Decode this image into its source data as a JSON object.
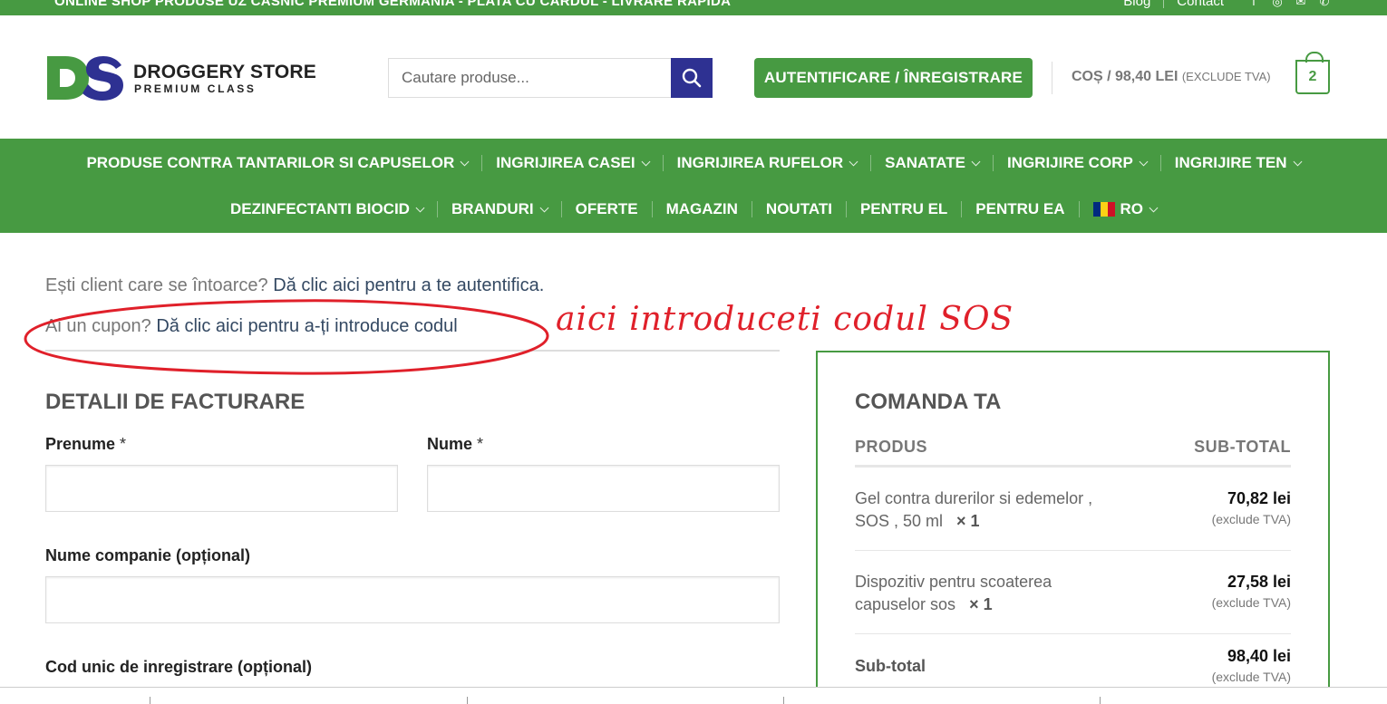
{
  "topbar": {
    "promo": "ONLINE SHOP PRODUSE UZ CASNIC PREMIUM GERMANIA - PLATA CU CARDUL - LIVRARE RAPIDA",
    "links": [
      "Blog",
      "Contact"
    ],
    "social_icons": [
      "facebook-icon",
      "instagram-icon",
      "email-icon",
      "phone-icon"
    ]
  },
  "header": {
    "logo_text": "DROGGERY STORE",
    "logo_tagline": "PREMIUM CLASS",
    "search_placeholder": "Cautare produse...",
    "login_label": "AUTENTIFICARE / ÎNREGISTRARE",
    "cart_label": "COȘ / 98,40 LEI",
    "cart_excl": "(EXCLUDE TVA)",
    "cart_count": "2",
    "colors": {
      "green": "#479a42",
      "navy": "#2e3192"
    }
  },
  "nav": {
    "row1": [
      {
        "label": "PRODUSE CONTRA TANTARILOR SI CAPUSELOR",
        "dropdown": true
      },
      {
        "label": "INGRIJIREA CASEI",
        "dropdown": true
      },
      {
        "label": "INGRIJIREA RUFELOR",
        "dropdown": true
      },
      {
        "label": "SANATATE",
        "dropdown": true
      },
      {
        "label": "INGRIJIRE CORP",
        "dropdown": true
      },
      {
        "label": "INGRIJIRE TEN",
        "dropdown": true
      }
    ],
    "row2": [
      {
        "label": "DEZINFECTANTI BIOCID",
        "dropdown": true
      },
      {
        "label": "BRANDURI",
        "dropdown": true
      },
      {
        "label": "OFERTE",
        "dropdown": false
      },
      {
        "label": "MAGAZIN",
        "dropdown": false
      },
      {
        "label": "NOUTATI",
        "dropdown": false
      },
      {
        "label": "PENTRU EL",
        "dropdown": false
      },
      {
        "label": "PENTRU EA",
        "dropdown": false
      }
    ],
    "language": "RO"
  },
  "notices": {
    "returning_text": "Ești client care se întoarce?",
    "returning_link": "Dă clic aici pentru a te autentifica.",
    "coupon_text": "Ai un cupon?",
    "coupon_link": "Dă clic aici pentru a-ți introduce codul"
  },
  "annotation": {
    "text": "aici introduceti codul SOS",
    "color": "#e0202a"
  },
  "billing": {
    "title": "DETALII DE FACTURARE",
    "first_name_label": "Prenume",
    "last_name_label": "Nume",
    "required_mark": "*",
    "company_label": "Nume companie (opțional)",
    "cui_label": "Cod unic de inregistrare (opțional)"
  },
  "order": {
    "title": "COMANDA TA",
    "col_product": "PRODUS",
    "col_subtotal": "SUB-TOTAL",
    "items": [
      {
        "name": "Gel contra durerilor si edemelor , SOS , 50 ml",
        "qty": "× 1",
        "price": "70,82 lei",
        "note": "(exclude TVA)"
      },
      {
        "name": "Dispozitiv pentru scoaterea capuselor sos",
        "qty": "× 1",
        "price": "27,58 lei",
        "note": "(exclude TVA)"
      }
    ],
    "subtotal_label": "Sub-total",
    "subtotal_value": "98,40 lei",
    "subtotal_note": "(exclude TVA)"
  }
}
